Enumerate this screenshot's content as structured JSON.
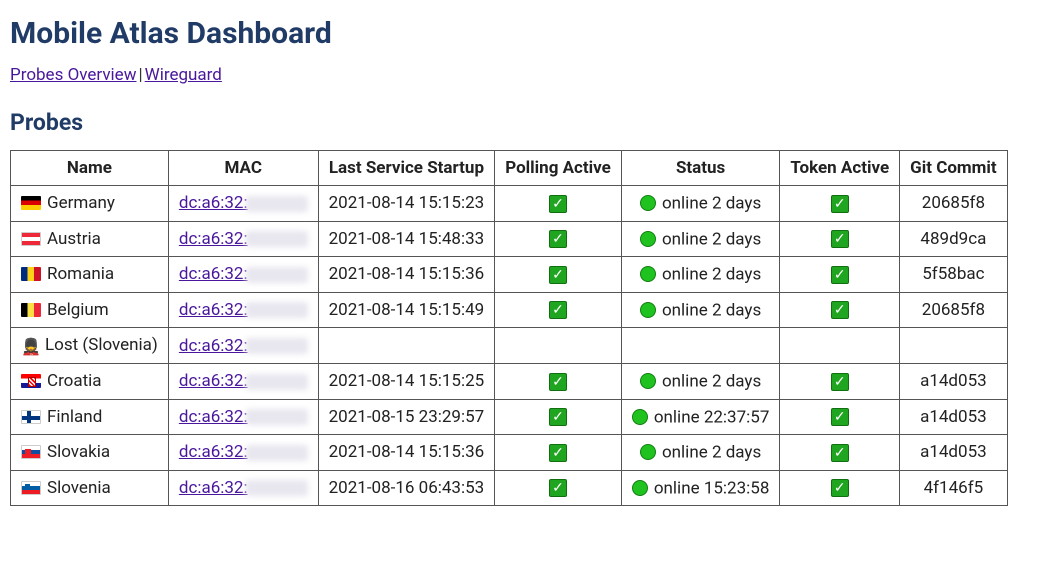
{
  "title": "Mobile Atlas Dashboard",
  "nav": {
    "probes_overview": "Probes Overview",
    "wireguard": "Wireguard"
  },
  "sectionTitle": "Probes",
  "columns": {
    "name": "Name",
    "mac": "MAC",
    "lastStartup": "Last Service Startup",
    "polling": "Polling Active",
    "status": "Status",
    "token": "Token Active",
    "git": "Git Commit"
  },
  "macPrefix": "dc:a6:32:",
  "rows": [
    {
      "flag": "de",
      "name": "Germany",
      "lastStartup": "2021-08-14 15:15:23",
      "polling": true,
      "status": "online 2 days",
      "token": true,
      "git": "20685f8"
    },
    {
      "flag": "at",
      "name": "Austria",
      "lastStartup": "2021-08-14 15:48:33",
      "polling": true,
      "status": "online 2 days",
      "token": true,
      "git": "489d9ca"
    },
    {
      "flag": "ro",
      "name": "Romania",
      "lastStartup": "2021-08-14 15:15:36",
      "polling": true,
      "status": "online 2 days",
      "token": true,
      "git": "5f58bac"
    },
    {
      "flag": "be",
      "name": "Belgium",
      "lastStartup": "2021-08-14 15:15:49",
      "polling": true,
      "status": "online 2 days",
      "token": true,
      "git": "20685f8"
    },
    {
      "flag": "lost",
      "name": "Lost (Slovenia)",
      "lastStartup": "",
      "polling": null,
      "status": "",
      "token": null,
      "git": ""
    },
    {
      "flag": "hr",
      "name": "Croatia",
      "lastStartup": "2021-08-14 15:15:25",
      "polling": true,
      "status": "online 2 days",
      "token": true,
      "git": "a14d053"
    },
    {
      "flag": "fi",
      "name": "Finland",
      "lastStartup": "2021-08-15 23:29:57",
      "polling": true,
      "status": "online 22:37:57",
      "token": true,
      "git": "a14d053"
    },
    {
      "flag": "sk",
      "name": "Slovakia",
      "lastStartup": "2021-08-14 15:15:36",
      "polling": true,
      "status": "online 2 days",
      "token": true,
      "git": "a14d053"
    },
    {
      "flag": "si",
      "name": "Slovenia",
      "lastStartup": "2021-08-16 06:43:53",
      "polling": true,
      "status": "online 15:23:58",
      "token": true,
      "git": "4f146f5"
    }
  ]
}
